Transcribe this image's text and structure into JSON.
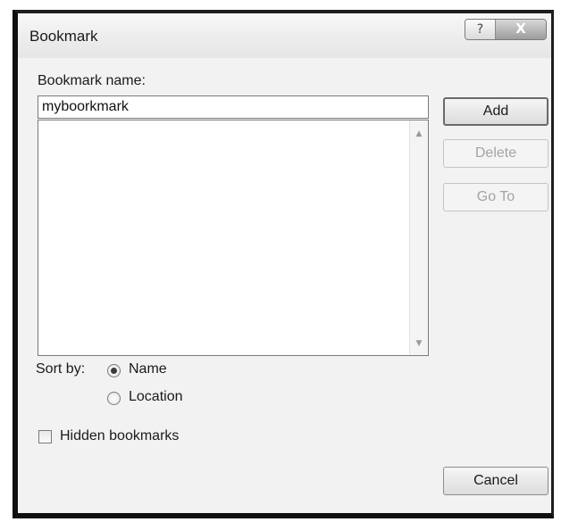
{
  "window": {
    "title": "Bookmark",
    "help_glyph": "?",
    "close_glyph": "X"
  },
  "form": {
    "bookmark_name_label": "Bookmark name:",
    "bookmark_name_value": "myboorkmark",
    "bookmark_list_items": [],
    "sort_label": "Sort by:",
    "sort_options": [
      {
        "label": "Name",
        "selected": true
      },
      {
        "label": "Location",
        "selected": false
      }
    ],
    "hidden_bookmarks_label": "Hidden bookmarks",
    "hidden_bookmarks_checked": false
  },
  "buttons": {
    "add": "Add",
    "delete": "Delete",
    "goto": "Go To",
    "cancel": "Cancel"
  },
  "scrollbar": {
    "up_icon": "scroll-up-arrow-icon",
    "down_icon": "scroll-down-arrow-icon"
  }
}
